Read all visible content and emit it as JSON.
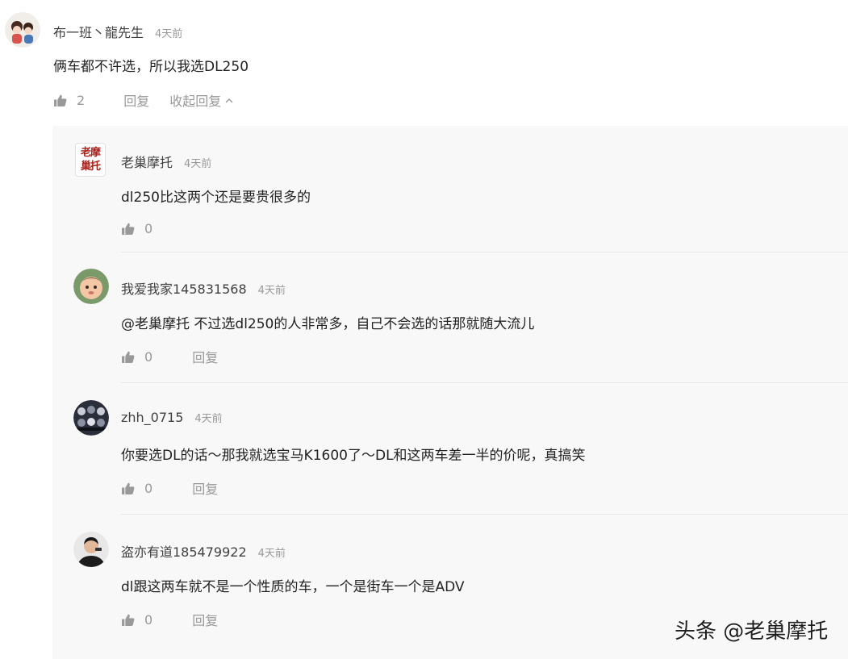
{
  "top_comment": {
    "username": "布一班丶龍先生",
    "time": "4天前",
    "text": "俩车都不许选，所以我选DL250",
    "like_count": "2",
    "reply_label": "回复",
    "collapse_label": "收起回复"
  },
  "replies": [
    {
      "username": "老巢摩托",
      "time": "4天前",
      "text": "dl250比这两个还是要贵很多的",
      "like_count": "0",
      "avatar_text": "老摩巢托"
    },
    {
      "username": "我爱我家145831568",
      "time": "4天前",
      "text": "@老巢摩托 不过选dl250的人非常多，自己不会选的话那就随大流儿",
      "like_count": "0",
      "reply_label": "回复"
    },
    {
      "username": "zhh_0715",
      "time": "4天前",
      "text": "你要选DL的话～那我就选宝马K1600了～DL和这两车差一半的价呢，真搞笑",
      "like_count": "0",
      "reply_label": "回复"
    },
    {
      "username": "盗亦有道185479922",
      "time": "4天前",
      "text": "dl跟这两车就不是一个性质的车，一个是街车一个是ADV",
      "like_count": "0",
      "reply_label": "回复"
    }
  ],
  "watermark": "头条 @老巢摩托",
  "icons": {
    "like": "thumbs-up-icon",
    "collapse": "chevron-up-icon"
  },
  "colors": {
    "text": "#222222",
    "muted": "#999999",
    "thread_bg": "#f8f8f8"
  }
}
